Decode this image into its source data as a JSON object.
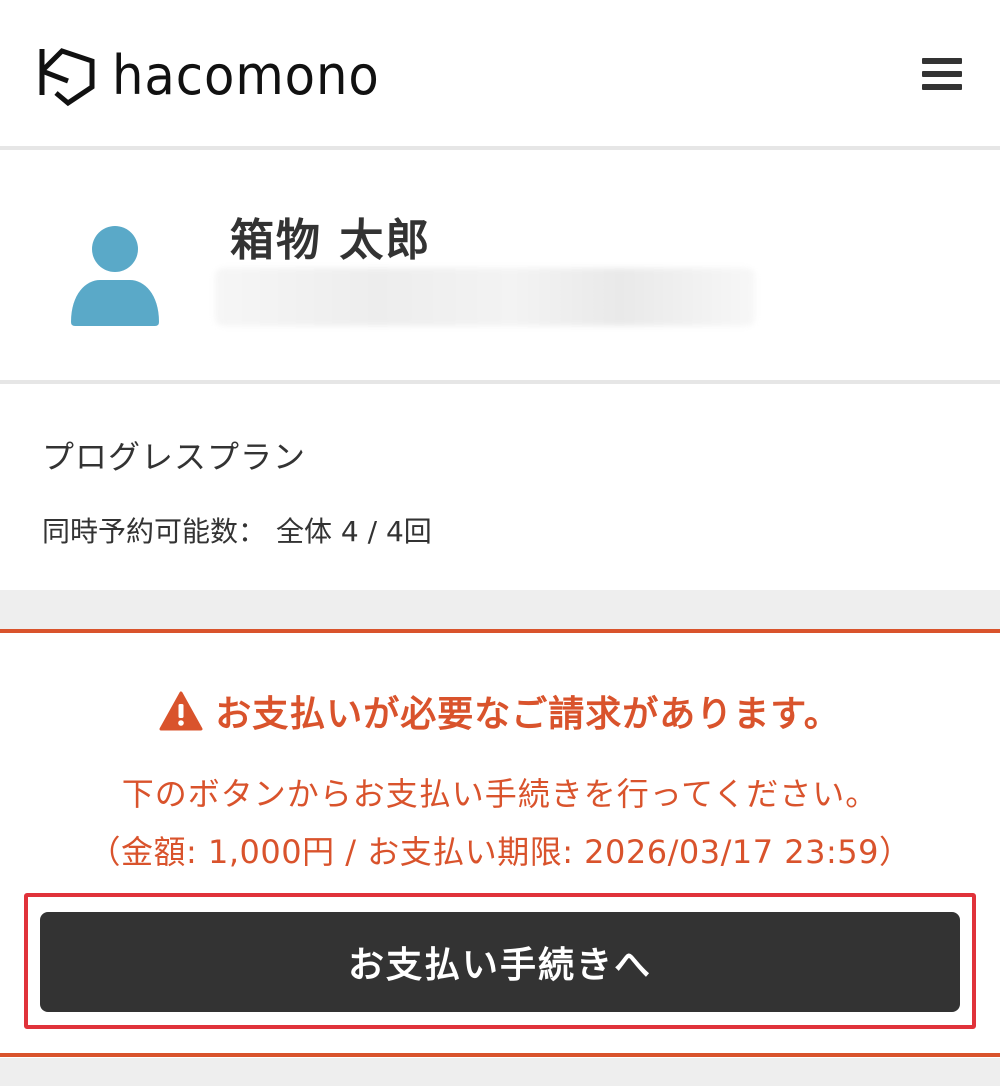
{
  "header": {
    "logo_text": "hacomono",
    "menu_icon": "hamburger-menu-icon"
  },
  "profile": {
    "name": "箱物 太郎",
    "avatar_icon": "user-avatar-icon",
    "avatar_color": "#5aa9c8"
  },
  "plan": {
    "name": "プログレスプラン",
    "reserve_label": "同時予約可能数：",
    "reserve_value": "全体 4 / 4回"
  },
  "notice": {
    "warning_icon": "warning-triangle-icon",
    "title": "お支払いが必要なご請求があります。",
    "message": "下のボタンからお支払い手続きを行ってください。",
    "detail": "（金額: 1,000円 / お支払い期限: 2026/03/17 23:59）",
    "accent_color": "#d9532c"
  },
  "action": {
    "pay_button_label": "お支払い手続きへ"
  }
}
